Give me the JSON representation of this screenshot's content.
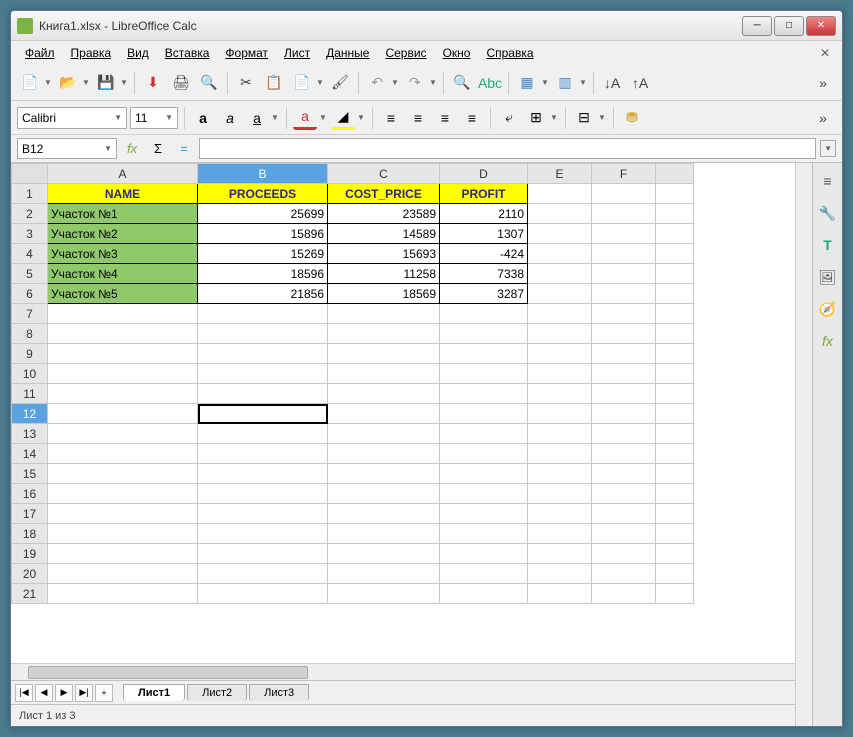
{
  "title": "Книга1.xlsx - LibreOffice Calc",
  "menu": [
    "Файл",
    "Правка",
    "Вид",
    "Вставка",
    "Формат",
    "Лист",
    "Данные",
    "Сервис",
    "Окно",
    "Справка"
  ],
  "font": {
    "name": "Calibri",
    "size": "11"
  },
  "cellref": "B12",
  "cursor": {
    "row": 12,
    "col": "B"
  },
  "columns": [
    "A",
    "B",
    "C",
    "D",
    "E",
    "F",
    ""
  ],
  "rows": 21,
  "sheet": {
    "headers": {
      "A": "NAME",
      "B": "PROCEEDS",
      "C": "COST_PRICE",
      "D": "PROFIT"
    },
    "data": [
      {
        "name": "Участок №1",
        "proceeds": "25699",
        "cost": "23589",
        "profit": "2110"
      },
      {
        "name": "Участок №2",
        "proceeds": "15896",
        "cost": "14589",
        "profit": "1307"
      },
      {
        "name": "Участок №3",
        "proceeds": "15269",
        "cost": "15693",
        "profit": "-424"
      },
      {
        "name": "Участок №4",
        "proceeds": "18596",
        "cost": "11258",
        "profit": "7338"
      },
      {
        "name": "Участок №5",
        "proceeds": "21856",
        "cost": "18569",
        "profit": "3287"
      }
    ]
  },
  "tabs": [
    "Лист1",
    "Лист2",
    "Лист3"
  ],
  "active_tab": 0,
  "status": "Лист 1 из 3"
}
